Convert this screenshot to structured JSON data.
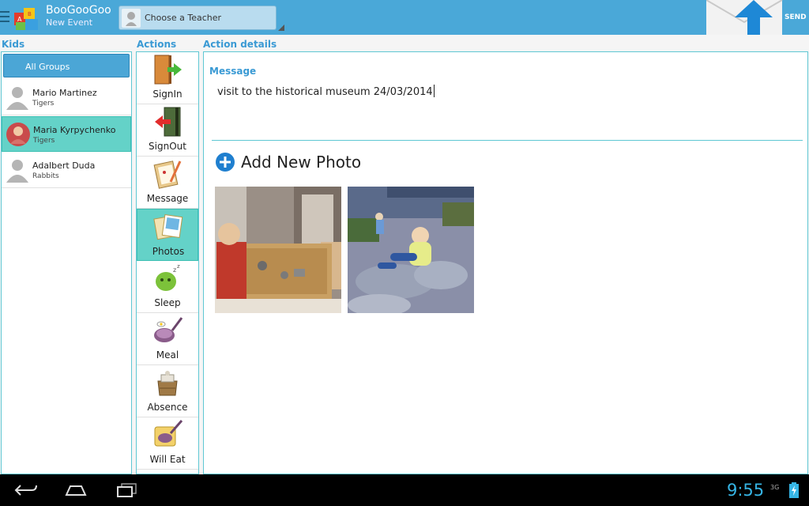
{
  "header": {
    "title": "BooGooGoo",
    "subtitle": "New Event",
    "teacher_placeholder": "Choose a Teacher",
    "send_label": "SEND"
  },
  "columns": {
    "kids": "Kids",
    "actions": "Actions",
    "details": "Action details"
  },
  "kids": {
    "all_groups": "All Groups",
    "items": [
      {
        "name": "Mario Martinez",
        "group": "Tigers"
      },
      {
        "name": "Maria Kyrpychenko",
        "group": "Tigers"
      },
      {
        "name": "Adalbert Duda",
        "group": "Rabbits"
      }
    ]
  },
  "actions": {
    "items": [
      {
        "label": "SignIn",
        "icon": "sign-in-door-icon"
      },
      {
        "label": "SignOut",
        "icon": "sign-out-door-icon"
      },
      {
        "label": "Message",
        "icon": "message-clipboard-icon"
      },
      {
        "label": "Photos",
        "icon": "photos-icon"
      },
      {
        "label": "Sleep",
        "icon": "sleep-icon"
      },
      {
        "label": "Meal",
        "icon": "meal-pan-icon"
      },
      {
        "label": "Absence",
        "icon": "absence-bag-icon"
      },
      {
        "label": "Will Eat",
        "icon": "will-eat-icon"
      }
    ]
  },
  "details": {
    "message_label": "Message",
    "message_value": "visit to the historical museum 24/03/2014",
    "add_photo_label": "Add New Photo"
  },
  "system": {
    "time": "9:55",
    "network": "3G"
  },
  "colors": {
    "topbar": "#4aa8d8",
    "accent": "#3a9ad4",
    "selected": "#64d2c8",
    "clock": "#36b5e5"
  }
}
